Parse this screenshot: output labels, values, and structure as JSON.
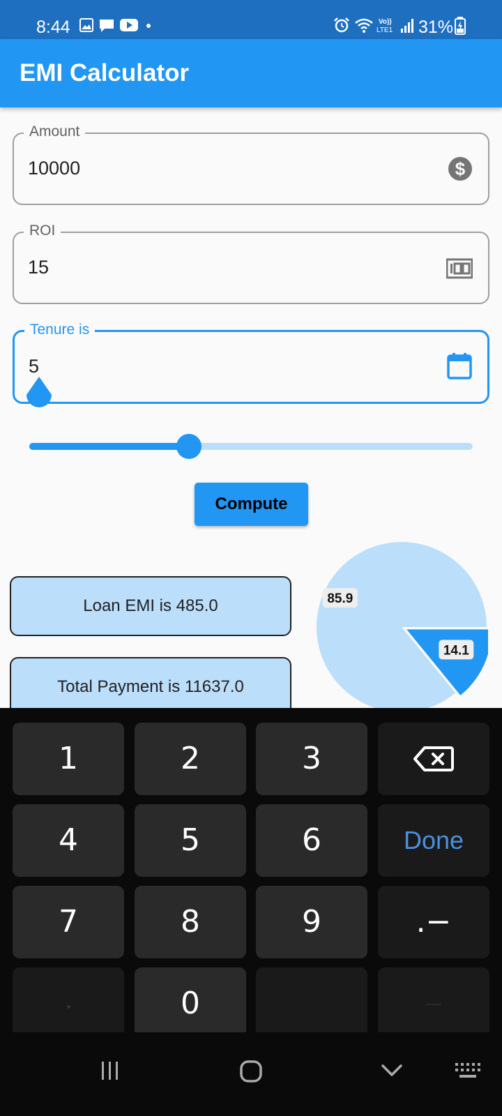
{
  "status_bar": {
    "time": "8:44",
    "battery": "31%"
  },
  "app_bar": {
    "title": "EMI Calculator"
  },
  "fields": {
    "amount": {
      "label": "Amount",
      "value": "10000"
    },
    "roi": {
      "label": "ROI",
      "value": "15"
    },
    "tenure": {
      "label": "Tenure is",
      "value": "5"
    }
  },
  "slider": {
    "value_fraction": 0.36
  },
  "compute_button": {
    "label": "Compute"
  },
  "results": {
    "emi": "Loan EMI is 485.0",
    "total": "Total Payment is 11637.0"
  },
  "chart_data": {
    "type": "pie",
    "slices": [
      {
        "label": "85.9",
        "value": 85.9,
        "color": "#bbdefb"
      },
      {
        "label": "14.1",
        "value": 14.1,
        "color": "#2196f3"
      }
    ]
  },
  "keyboard": {
    "keys": [
      "1",
      "2",
      "3",
      "4",
      "5",
      "6",
      "7",
      "8",
      "9",
      "0",
      ".−"
    ],
    "done_label": "Done"
  },
  "colors": {
    "primary": "#2196f3",
    "primary_light": "#bbdefb",
    "status_bar": "#1e6fc0"
  }
}
